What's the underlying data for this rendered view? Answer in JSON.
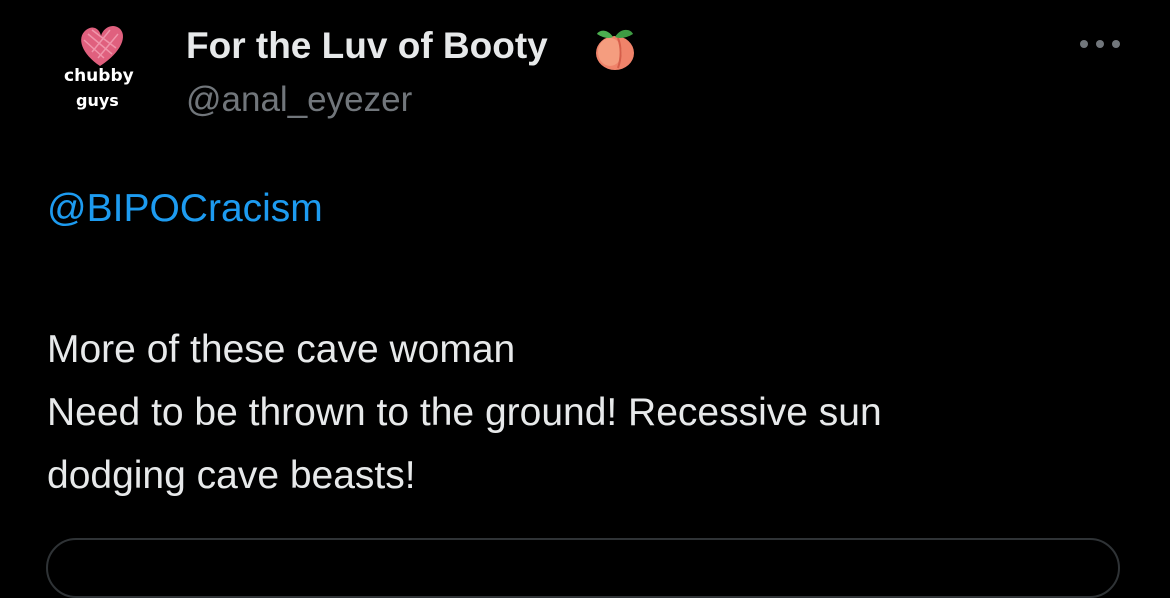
{
  "avatar": {
    "line1": "chubby",
    "line2": "guys",
    "icon": "pink-heart-logo"
  },
  "author": {
    "display_name": "For the Luv of Booty",
    "name_emoji": "peach-icon",
    "handle": "@anal_eyezer"
  },
  "menu": {
    "icon": "more-horizontal-icon"
  },
  "tweet": {
    "mention": "@BIPOCracism",
    "lines": [
      "More of these cave woman",
      "Need to be thrown to the ground! Recessive sun",
      "dodging cave beasts!"
    ]
  },
  "colors": {
    "background": "#000000",
    "text": "#e7e9ea",
    "secondary_text": "#71767b",
    "link": "#1d9bf0",
    "border": "#2f3336"
  }
}
